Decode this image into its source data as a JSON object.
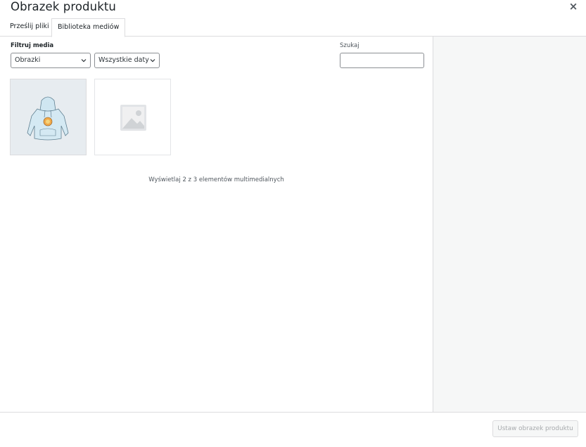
{
  "modal": {
    "title": "Obrazek produktu",
    "close_symbol": "×"
  },
  "tabs": [
    {
      "label": "Prześlij pliki",
      "active": false
    },
    {
      "label": "Biblioteka mediów",
      "active": true
    }
  ],
  "filters": {
    "label": "Filtruj media",
    "type_select": {
      "value": "Obrazki"
    },
    "date_select": {
      "value": "Wszystkie daty"
    }
  },
  "search": {
    "label": "Szukaj",
    "value": ""
  },
  "attachments": [
    {
      "kind": "image",
      "icon": "hoodie-image"
    },
    {
      "kind": "placeholder",
      "icon": "image-placeholder-icon"
    }
  ],
  "count_text": "Wyświetlaj 2 z 3 elementów multimedialnych",
  "footer": {
    "primary_button": "Ustaw obrazek produktu"
  },
  "colors": {
    "border": "#dcdcde",
    "sidebar_bg": "#f6f7f7",
    "thumb_bg": "#e7ecf0",
    "disabled_text": "#a7aaad"
  }
}
